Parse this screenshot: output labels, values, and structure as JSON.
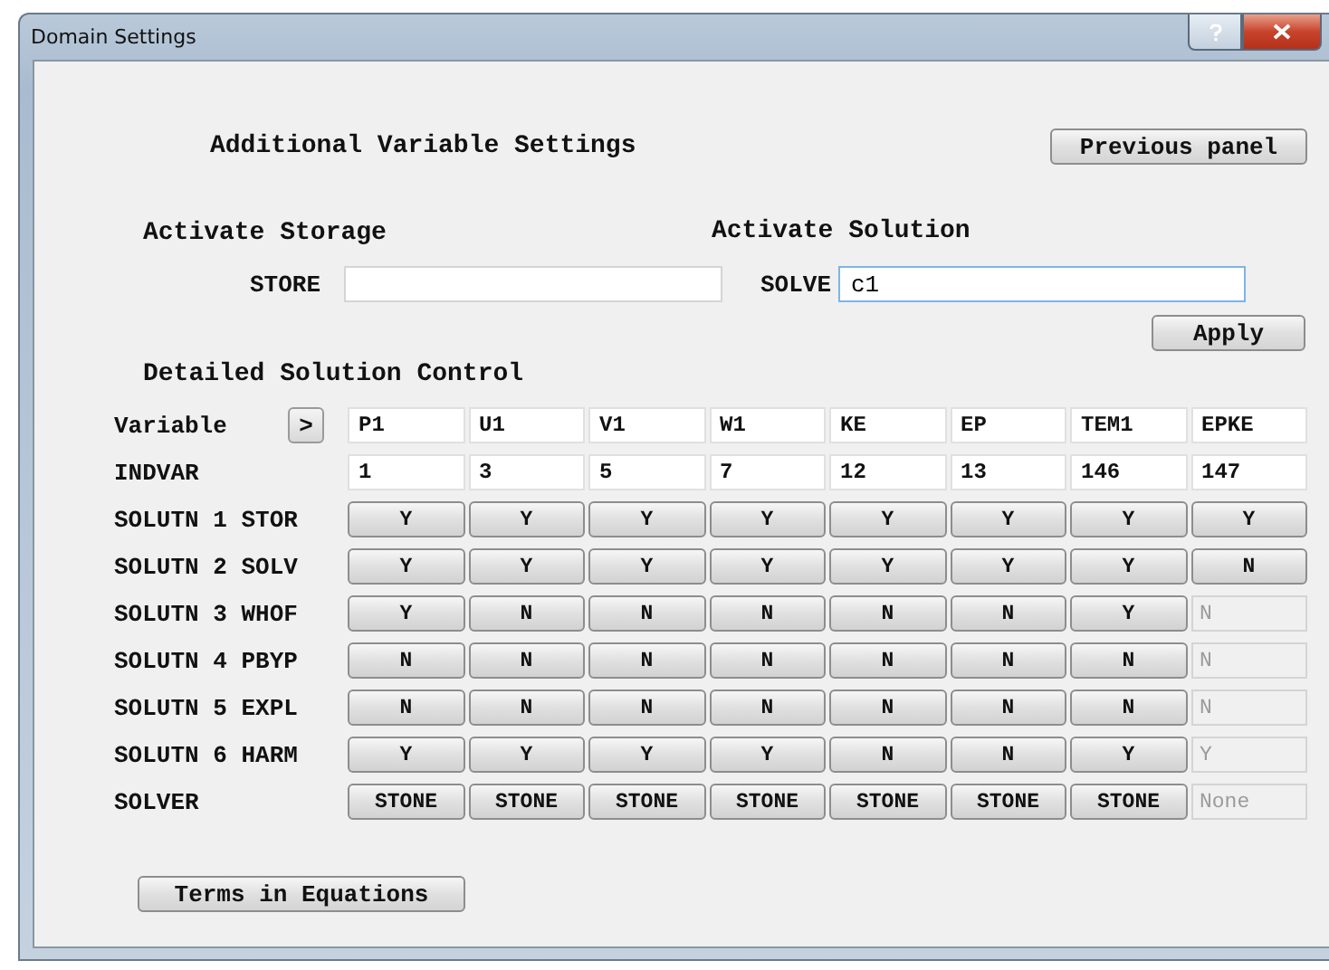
{
  "window": {
    "title": "Domain Settings"
  },
  "heading": "Additional Variable Settings",
  "previous_button": "Previous panel",
  "storage": {
    "heading": "Activate Storage",
    "label": "STORE"
  },
  "solution": {
    "heading": "Activate Solution",
    "label": "SOLVE",
    "value": "c1"
  },
  "apply_button": "Apply",
  "detailed": {
    "heading": "Detailed Solution Control",
    "variable_label": "Variable",
    "scroll_button": ">",
    "variables": [
      "P1",
      "U1",
      "V1",
      "W1",
      "KE",
      "EP",
      "TEM1",
      "EPKE"
    ],
    "indvar_label": "INDVAR",
    "indvars": [
      "1",
      "3",
      "5",
      "7",
      "12",
      "13",
      "146",
      "147"
    ],
    "rows": [
      {
        "label": "SOLUTN 1 STOR",
        "cells": [
          {
            "value": "Y",
            "disabled": false
          },
          {
            "value": "Y",
            "disabled": false
          },
          {
            "value": "Y",
            "disabled": false
          },
          {
            "value": "Y",
            "disabled": false
          },
          {
            "value": "Y",
            "disabled": false
          },
          {
            "value": "Y",
            "disabled": false
          },
          {
            "value": "Y",
            "disabled": false
          },
          {
            "value": "Y",
            "disabled": false
          }
        ]
      },
      {
        "label": "SOLUTN 2 SOLV",
        "cells": [
          {
            "value": "Y",
            "disabled": false
          },
          {
            "value": "Y",
            "disabled": false
          },
          {
            "value": "Y",
            "disabled": false
          },
          {
            "value": "Y",
            "disabled": false
          },
          {
            "value": "Y",
            "disabled": false
          },
          {
            "value": "Y",
            "disabled": false
          },
          {
            "value": "Y",
            "disabled": false
          },
          {
            "value": "N",
            "disabled": false
          }
        ]
      },
      {
        "label": "SOLUTN 3 WHOF",
        "cells": [
          {
            "value": "Y",
            "disabled": false
          },
          {
            "value": "N",
            "disabled": false
          },
          {
            "value": "N",
            "disabled": false
          },
          {
            "value": "N",
            "disabled": false
          },
          {
            "value": "N",
            "disabled": false
          },
          {
            "value": "N",
            "disabled": false
          },
          {
            "value": "Y",
            "disabled": false
          },
          {
            "value": "N",
            "disabled": true
          }
        ]
      },
      {
        "label": "SOLUTN 4 PBYP",
        "cells": [
          {
            "value": "N",
            "disabled": false
          },
          {
            "value": "N",
            "disabled": false
          },
          {
            "value": "N",
            "disabled": false
          },
          {
            "value": "N",
            "disabled": false
          },
          {
            "value": "N",
            "disabled": false
          },
          {
            "value": "N",
            "disabled": false
          },
          {
            "value": "N",
            "disabled": false
          },
          {
            "value": "N",
            "disabled": true
          }
        ]
      },
      {
        "label": "SOLUTN 5 EXPL",
        "cells": [
          {
            "value": "N",
            "disabled": false
          },
          {
            "value": "N",
            "disabled": false
          },
          {
            "value": "N",
            "disabled": false
          },
          {
            "value": "N",
            "disabled": false
          },
          {
            "value": "N",
            "disabled": false
          },
          {
            "value": "N",
            "disabled": false
          },
          {
            "value": "N",
            "disabled": false
          },
          {
            "value": "N",
            "disabled": true
          }
        ]
      },
      {
        "label": "SOLUTN 6 HARM",
        "cells": [
          {
            "value": "Y",
            "disabled": false
          },
          {
            "value": "Y",
            "disabled": false
          },
          {
            "value": "Y",
            "disabled": false
          },
          {
            "value": "Y",
            "disabled": false
          },
          {
            "value": "N",
            "disabled": false
          },
          {
            "value": "N",
            "disabled": false
          },
          {
            "value": "Y",
            "disabled": false
          },
          {
            "value": "Y",
            "disabled": true
          }
        ]
      },
      {
        "label": "SOLVER",
        "cells": [
          {
            "value": "STONE",
            "disabled": false
          },
          {
            "value": "STONE",
            "disabled": false
          },
          {
            "value": "STONE",
            "disabled": false
          },
          {
            "value": "STONE",
            "disabled": false
          },
          {
            "value": "STONE",
            "disabled": false
          },
          {
            "value": "STONE",
            "disabled": false
          },
          {
            "value": "STONE",
            "disabled": false
          },
          {
            "value": "None",
            "disabled": true
          }
        ]
      }
    ]
  },
  "terms_button": "Terms in Equations"
}
